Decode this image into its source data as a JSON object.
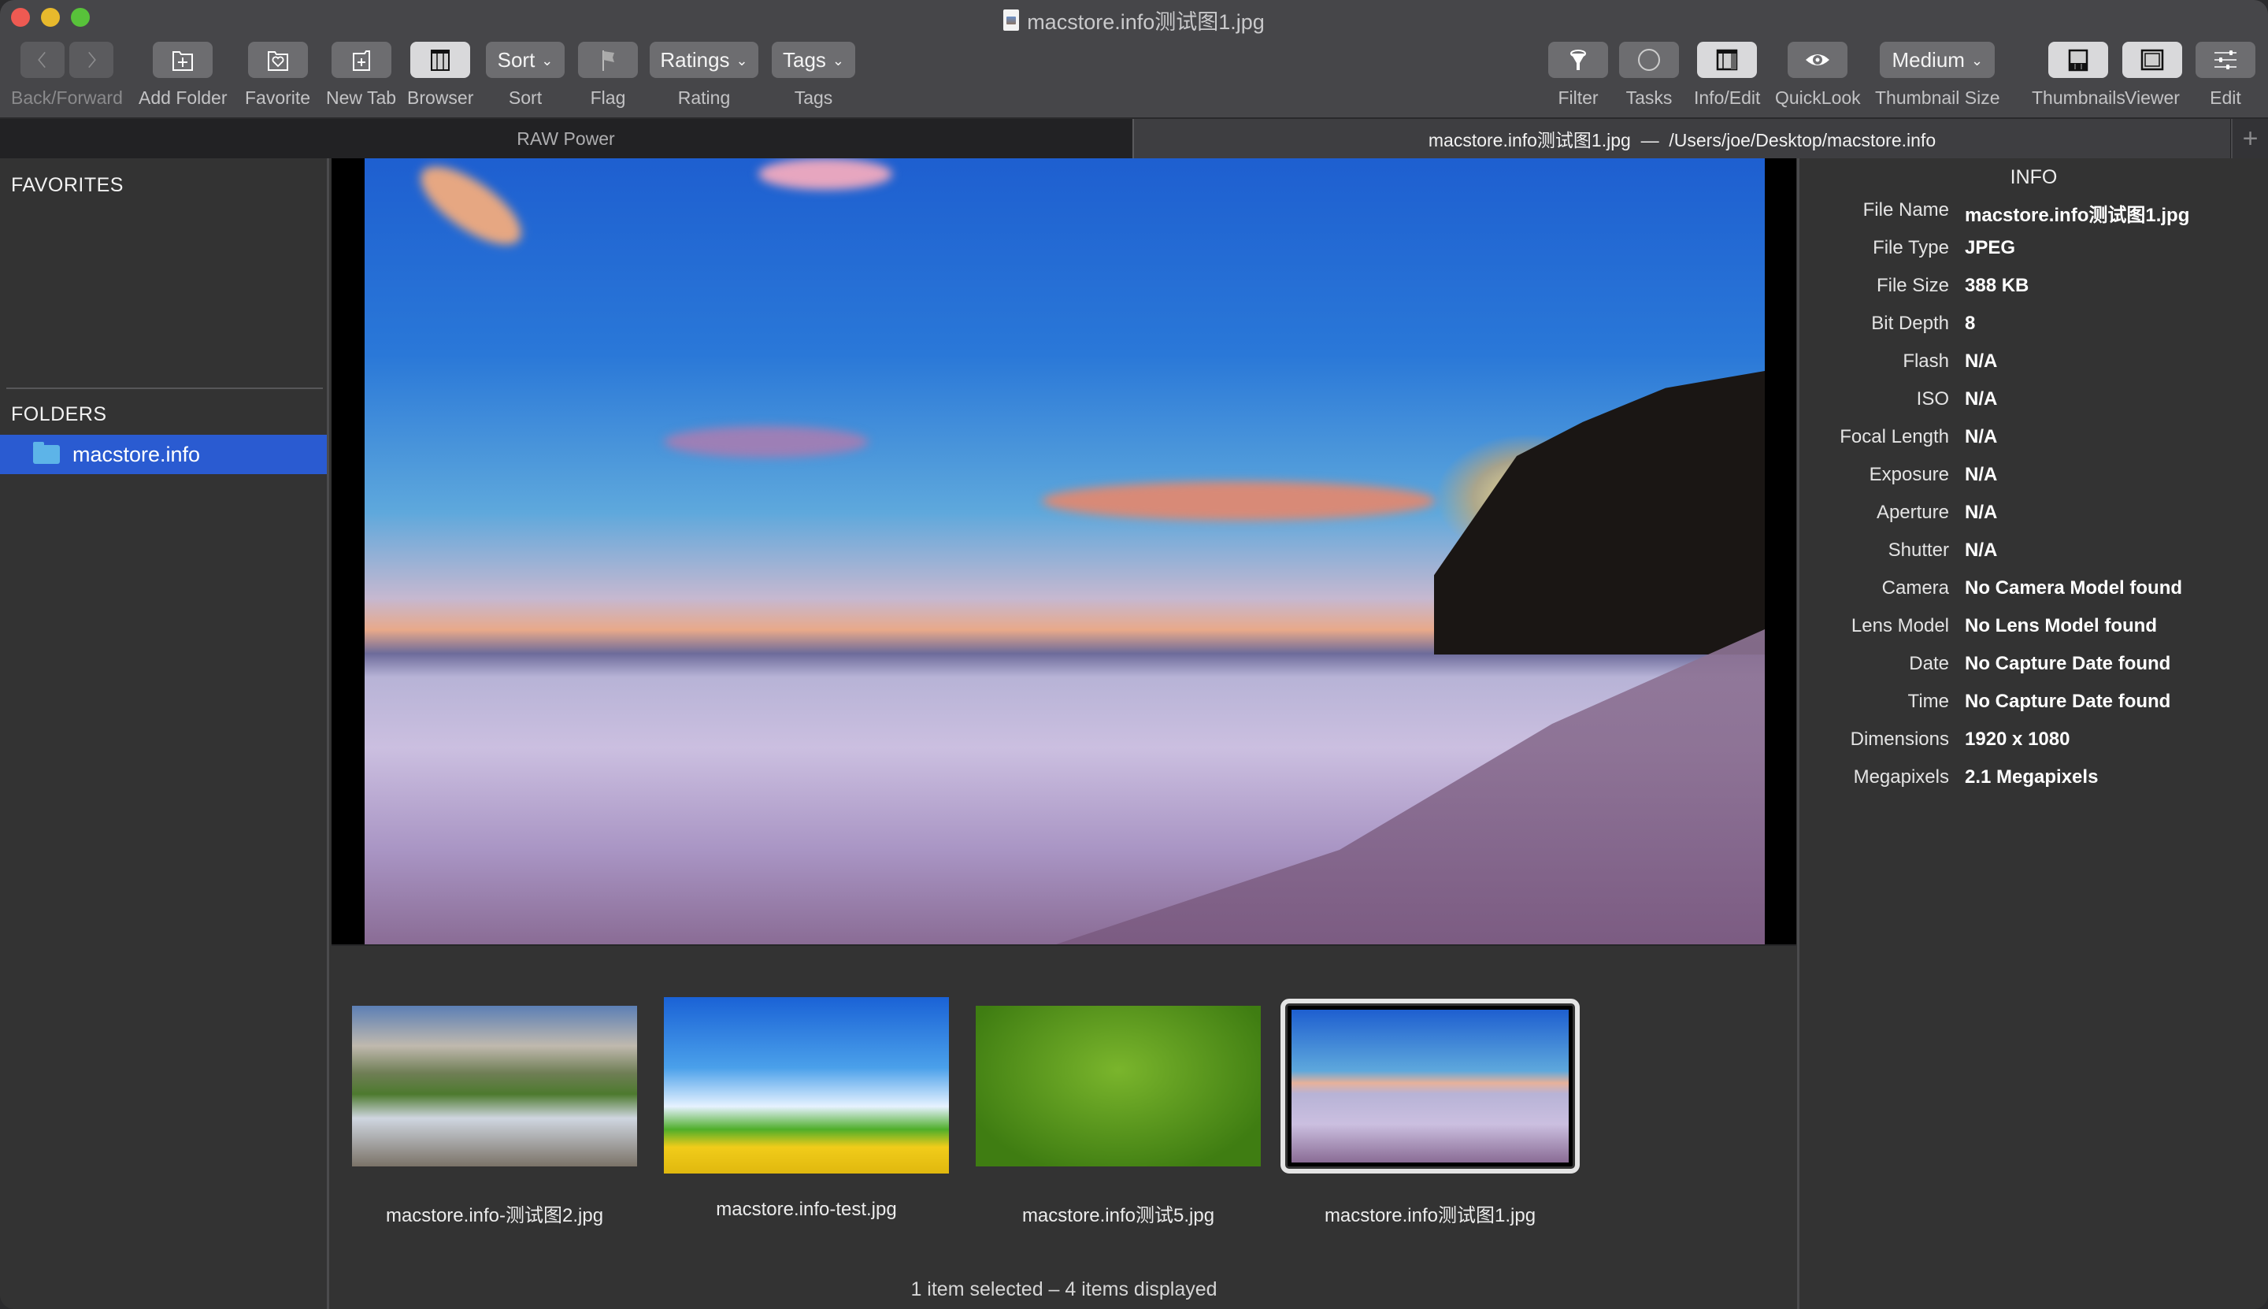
{
  "window": {
    "title": "macstore.info测试图1.jpg"
  },
  "toolbar": {
    "back_forward_label": "Back/Forward",
    "add_folder_label": "Add Folder",
    "favorite_label": "Favorite",
    "new_tab_label": "New Tab",
    "browser_label": "Browser",
    "sort_button": "Sort",
    "sort_label": "Sort",
    "flag_label": "Flag",
    "ratings_button": "Ratings",
    "rating_label": "Rating",
    "tags_button": "Tags",
    "tags_label": "Tags",
    "filter_label": "Filter",
    "tasks_label": "Tasks",
    "info_edit_label": "Info/Edit",
    "quicklook_label": "QuickLook",
    "thumbnail_size_value": "Medium",
    "thumbnail_size_label": "Thumbnail Size",
    "thumbnails_label": "Thumbnails",
    "viewer_label": "Viewer",
    "edit_label": "Edit"
  },
  "tabs": [
    {
      "label": "RAW Power",
      "active": false
    },
    {
      "label": "macstore.info测试图1.jpg  —  /Users/joe/Desktop/macstore.info",
      "active": true
    }
  ],
  "tab_add": "+",
  "sidebar": {
    "favorites_header": "FAVORITES",
    "folders_header": "FOLDERS",
    "folders": [
      {
        "label": "macstore.info",
        "selected": true
      }
    ]
  },
  "thumbnails": [
    {
      "name": "macstore.info-测试图2.jpg",
      "selected": false
    },
    {
      "name": "macstore.info-test.jpg",
      "selected": false
    },
    {
      "name": "macstore.info测试5.jpg",
      "selected": false
    },
    {
      "name": "macstore.info测试图1.jpg",
      "selected": true
    }
  ],
  "status": "1 item selected – 4 items displayed",
  "info": {
    "title": "INFO",
    "rows": [
      {
        "key": "File Name",
        "value": "macstore.info测试图1.jpg"
      },
      {
        "key": "File Type",
        "value": "JPEG"
      },
      {
        "key": "File Size",
        "value": "388 KB"
      },
      {
        "key": "Bit Depth",
        "value": "8"
      },
      {
        "key": "Flash",
        "value": "N/A"
      },
      {
        "key": "ISO",
        "value": "N/A"
      },
      {
        "key": "Focal Length",
        "value": "N/A"
      },
      {
        "key": "Exposure",
        "value": "N/A"
      },
      {
        "key": "Aperture",
        "value": "N/A"
      },
      {
        "key": "Shutter",
        "value": "N/A"
      },
      {
        "key": "Camera",
        "value": "No Camera Model found"
      },
      {
        "key": "Lens Model",
        "value": "No Lens Model found"
      },
      {
        "key": "Date",
        "value": "No Capture Date found"
      },
      {
        "key": "Time",
        "value": "No Capture Date found"
      },
      {
        "key": "Dimensions",
        "value": "1920 x 1080"
      },
      {
        "key": "Megapixels",
        "value": "2.1 Megapixels"
      }
    ]
  },
  "colors": {
    "selection": "#2a5bd1",
    "folder": "#5db4e8",
    "close": "#ee5a52",
    "minimize": "#e8b92c",
    "maximize": "#58c23a"
  }
}
